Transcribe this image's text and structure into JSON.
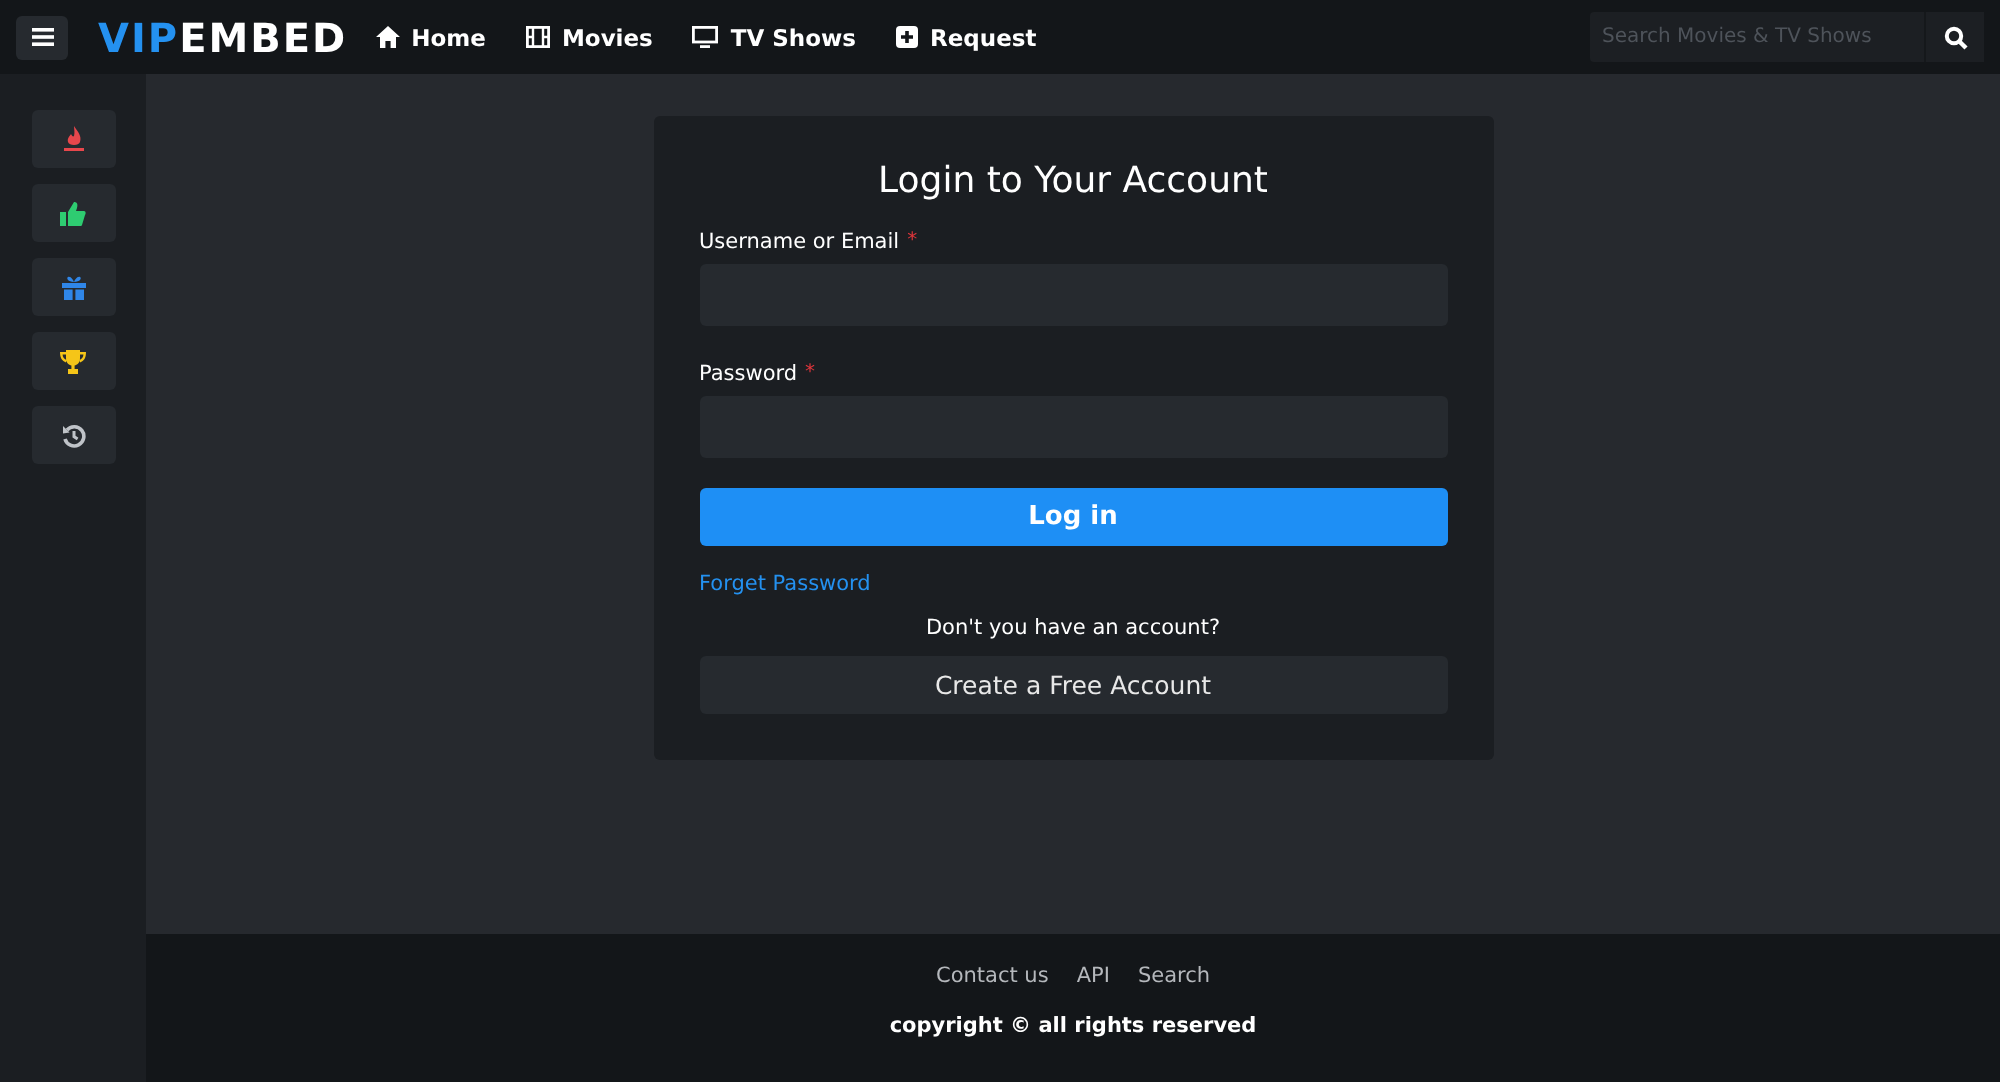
{
  "header": {
    "logo": {
      "accent": "VIP",
      "rest": "EMBED"
    },
    "nav": [
      {
        "kind": "home",
        "label": "Home"
      },
      {
        "kind": "film",
        "label": "Movies"
      },
      {
        "kind": "tv",
        "label": "TV Shows"
      },
      {
        "kind": "plus",
        "label": "Request"
      }
    ],
    "search": {
      "placeholder": "Search Movies & TV Shows"
    }
  },
  "sidebar": [
    {
      "kind": "fire",
      "color": "#e8474c"
    },
    {
      "kind": "thumb",
      "color": "#2ecc71"
    },
    {
      "kind": "gift",
      "color": "#2f86e8"
    },
    {
      "kind": "trophy",
      "color": "#f5c518"
    },
    {
      "kind": "history",
      "color": "#bfc3c8"
    }
  ],
  "login": {
    "title": "Login to Your Account",
    "fields": [
      {
        "label": "Username or Email",
        "marker": "*"
      },
      {
        "label": "Password",
        "marker": "*"
      }
    ],
    "submit": "Log in",
    "forgot": "Forget Password",
    "prompt": "Don't you have an account?",
    "create": "Create a Free Account"
  },
  "footer": {
    "links": [
      "Contact us",
      "API",
      "Search"
    ],
    "copyright": "copyright © all rights reserved"
  }
}
